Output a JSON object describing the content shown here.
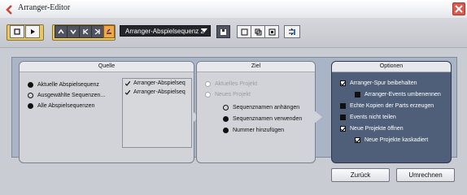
{
  "window": {
    "title": "Arranger-Editor"
  },
  "toolbar": {
    "dropdown_value": "Arranger-Abspielsequenz 2",
    "icons": [
      "square-stop-icon",
      "play-icon",
      "up-arrow-icon",
      "down-arrow-icon",
      "prev-marker-icon",
      "next-marker-icon",
      "orange-edit-icon",
      "save-icon",
      "add-icon",
      "duplicate-icon",
      "remove-icon",
      "flatten-icon"
    ]
  },
  "panels": {
    "quelle": {
      "title": "Quelle",
      "options": [
        {
          "label": "Aktuelle Abspielsequenz",
          "selected": true
        },
        {
          "label": "Ausgewählte Sequenzen...",
          "selected": false
        },
        {
          "label": "Alle Abspielsequenzen",
          "selected": true
        }
      ],
      "list": [
        {
          "label": "Arranger-Abspielseq",
          "checked": true
        },
        {
          "label": "Arranger-Abspielseq",
          "checked": true
        }
      ]
    },
    "ziel": {
      "title": "Ziel",
      "options": [
        {
          "label": "Aktuelles Projekt",
          "state": "disabled-selected"
        },
        {
          "label": "Neues Projekt",
          "state": "disabled"
        },
        {
          "label": "Sequenznamen anhängen",
          "state": "unselected"
        },
        {
          "label": "Sequenznamen verwenden",
          "state": "selected"
        },
        {
          "label": "Nummer hinzufügen",
          "state": "selected"
        }
      ]
    },
    "optionen": {
      "title": "Optionen",
      "items": [
        {
          "label": "Arranger-Spur beibehalten",
          "checked": true
        },
        {
          "label": "Arranger-Events umbenennen",
          "checked": false
        },
        {
          "label": "Echte Kopien der Parts erzeugen",
          "checked": false
        },
        {
          "label": "Events nicht teilen",
          "checked": false
        },
        {
          "label": "Neue Projekte öffnen",
          "checked": true
        },
        {
          "label": "Neue Projekte kaskadiert",
          "checked": true
        }
      ]
    }
  },
  "buttons": {
    "back": "Zurück",
    "calculate": "Umrechnen"
  }
}
